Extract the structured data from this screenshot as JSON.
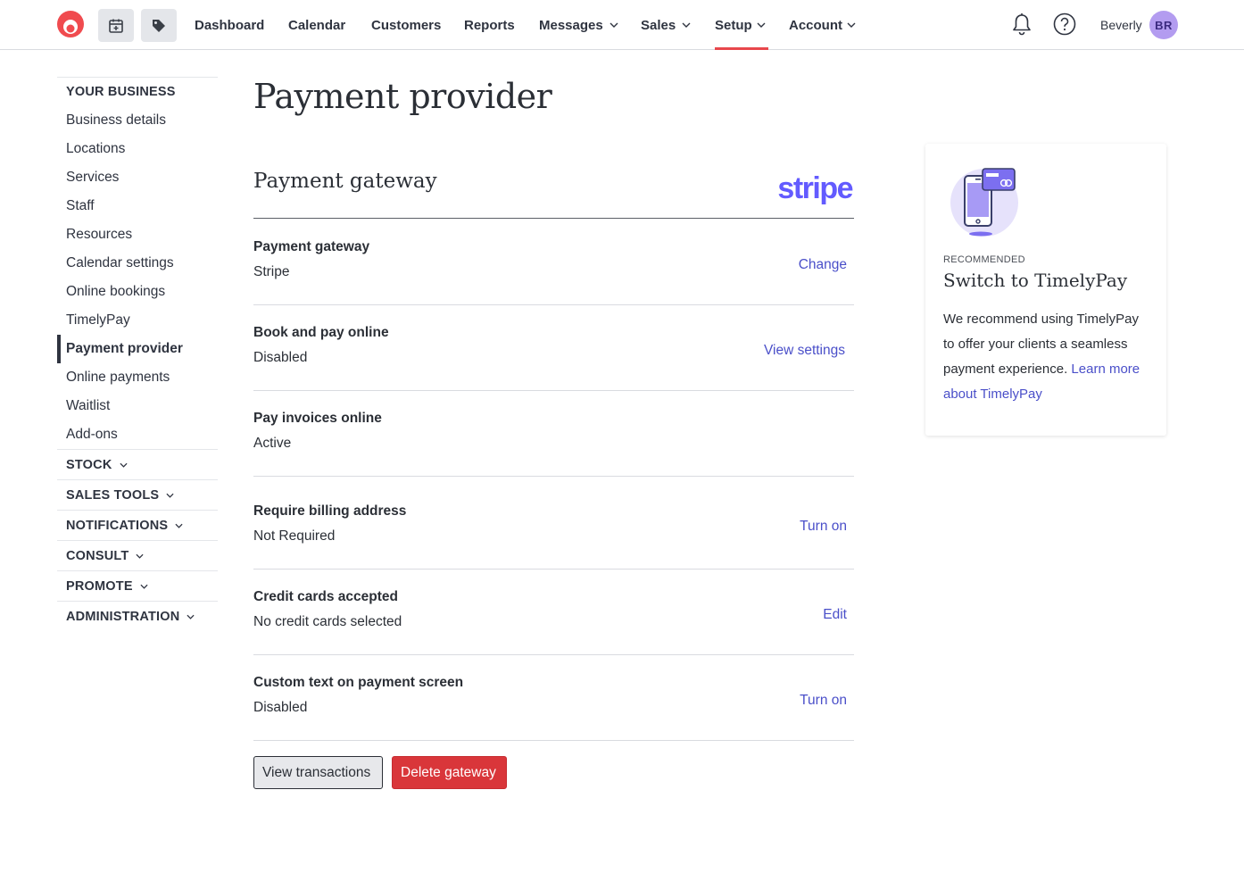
{
  "nav": {
    "items": [
      {
        "label": "Dashboard",
        "dropdown": false
      },
      {
        "label": "Calendar",
        "dropdown": false
      },
      {
        "label": "Customers",
        "dropdown": false
      },
      {
        "label": "Reports",
        "dropdown": false
      },
      {
        "label": "Messages",
        "dropdown": true
      },
      {
        "label": "Sales",
        "dropdown": true
      },
      {
        "label": "Setup",
        "dropdown": true,
        "active": true
      },
      {
        "label": "Account",
        "dropdown": true
      }
    ],
    "user_name": "Beverly",
    "avatar_initials": "BR",
    "icons": [
      "logo-icon",
      "add-appointment-icon",
      "sale-tag-icon",
      "bell-icon",
      "help-icon"
    ]
  },
  "sidebar": {
    "section_title": "YOUR BUSINESS",
    "items": [
      "Business details",
      "Locations",
      "Services",
      "Staff",
      "Resources",
      "Calendar settings",
      "Online bookings",
      "TimelyPay",
      "Payment provider",
      "Online payments",
      "Waitlist",
      "Add-ons"
    ],
    "active_item": "Payment provider",
    "groups": [
      "STOCK",
      "SALES TOOLS",
      "NOTIFICATIONS",
      "CONSULT",
      "PROMOTE",
      "ADMINISTRATION"
    ]
  },
  "main": {
    "title": "Payment provider",
    "section_title": "Payment gateway",
    "provider_logo_text": "stripe",
    "rows": [
      {
        "label": "Payment gateway",
        "value": "Stripe",
        "action": "Change"
      },
      {
        "label": "Book and pay online",
        "value": "Disabled",
        "action": "View settings"
      },
      {
        "label": "Pay invoices online",
        "value": "Active",
        "action": ""
      },
      {
        "label": "Require billing address",
        "value": "Not Required",
        "action": "Turn on"
      },
      {
        "label": "Credit cards accepted",
        "value": "No credit cards selected",
        "action": "Edit"
      },
      {
        "label": "Custom text on payment screen",
        "value": "Disabled",
        "action": "Turn on"
      }
    ],
    "buttons": {
      "view_transactions": "View transactions",
      "delete_gateway": "Delete gateway"
    }
  },
  "card": {
    "tag": "RECOMMENDED",
    "title": "Switch to TimelyPay",
    "body": "We recommend using TimelyPay to offer your clients a seamless payment experience.",
    "link": "Learn more about TimelyPay"
  },
  "colors": {
    "accent_red": "#e8474c",
    "link": "#4a4fc9",
    "stripe": "#635bff",
    "danger_button": "#d9363a",
    "avatar": "#b39cf0"
  }
}
